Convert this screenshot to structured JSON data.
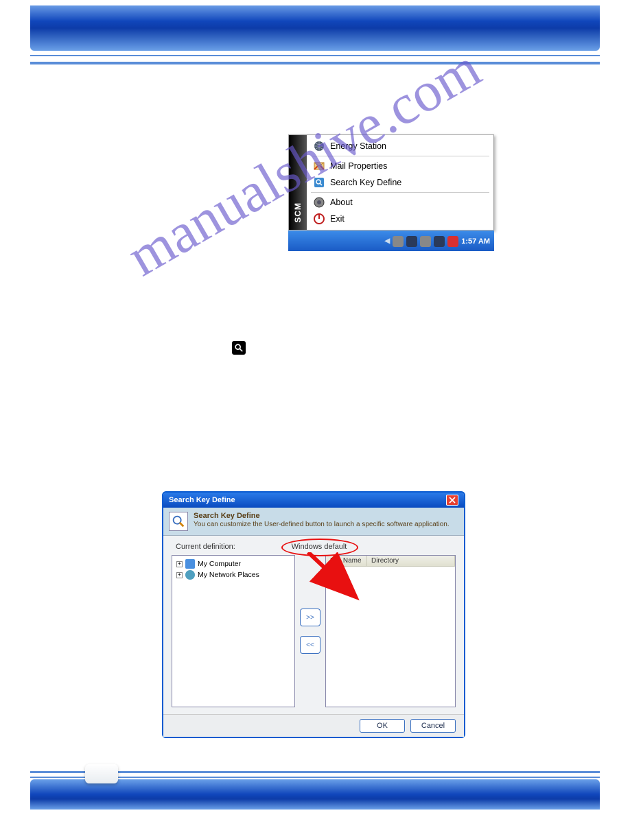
{
  "watermark_text": "manualshive.com",
  "scm_menu": {
    "side_label": "SCM",
    "items": [
      {
        "label": "Energy Station"
      },
      {
        "label": "Mail Properties"
      },
      {
        "label": "Search Key Define"
      },
      {
        "label": "About"
      },
      {
        "label": "Exit"
      }
    ]
  },
  "taskbar": {
    "time": "1:57 AM"
  },
  "dialog": {
    "title": "Search Key Define",
    "banner_title": "Search Key Define",
    "banner_text": "You can customize the User-defined button to launch a specific software application.",
    "current_def_label": "Current definition:",
    "current_def_value": "Windows default",
    "tree": {
      "items": [
        {
          "label": "My Computer"
        },
        {
          "label": "My Network Places"
        }
      ]
    },
    "mid_buttons": {
      "add": ">>",
      "remove": "<<"
    },
    "list": {
      "headers": {
        "file": "File Name",
        "dir": "Directory"
      }
    },
    "footer": {
      "ok": "OK",
      "cancel": "Cancel"
    }
  }
}
